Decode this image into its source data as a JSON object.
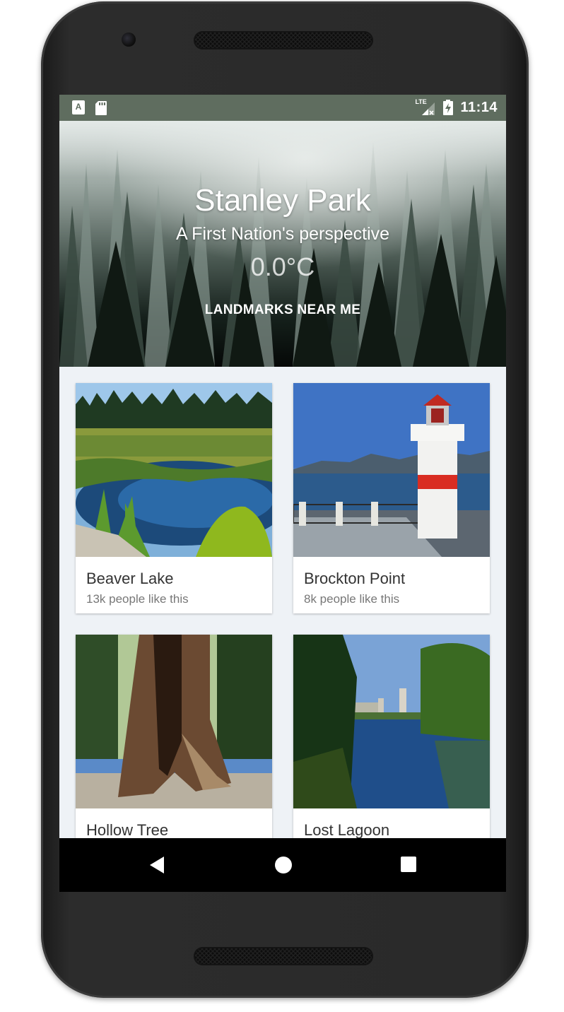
{
  "status_bar": {
    "time": "11:14",
    "network_label": "LTE",
    "left_icons": [
      "a-icon",
      "sd-card-icon"
    ],
    "right_icons": [
      "lte-signal-icon",
      "battery-charging-icon"
    ]
  },
  "hero": {
    "title": "Stanley Park",
    "subtitle": "A First Nation's perspective",
    "temperature": "0.0°C",
    "button_label": "LANDMARKS NEAR ME"
  },
  "landmarks": [
    {
      "name": "Beaver Lake",
      "likes": "13k people like this"
    },
    {
      "name": "Brockton Point",
      "likes": "8k people like this"
    },
    {
      "name": "Hollow Tree",
      "likes": ""
    },
    {
      "name": "Lost Lagoon",
      "likes": ""
    }
  ],
  "nav_bar": {
    "icons": [
      "back-icon",
      "home-icon",
      "recents-icon"
    ]
  },
  "colors": {
    "status_bar": "#5f6d5f",
    "screen_background": "#eef2f6",
    "nav_bar": "#000000"
  }
}
